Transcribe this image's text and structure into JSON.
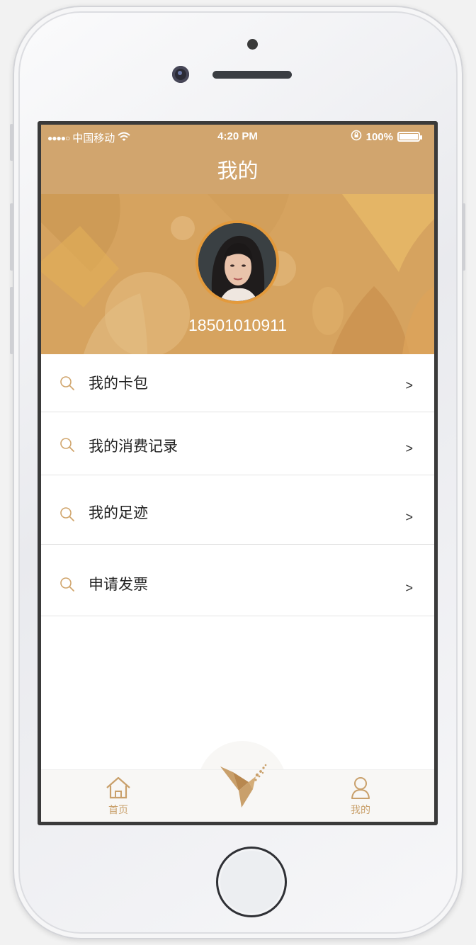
{
  "status_bar": {
    "signal": "●●●●○",
    "carrier": "中国移动",
    "time": "4:20 PM",
    "battery": "100%"
  },
  "header": {
    "title": "我的"
  },
  "profile": {
    "phone": "18501010911"
  },
  "menu": {
    "items": [
      {
        "label": "我的卡包",
        "icon": "search-icon",
        "arrow": ">"
      },
      {
        "label": "我的消费记录",
        "icon": "search-icon",
        "arrow": ">"
      },
      {
        "label": "我的足迹",
        "icon": "search-icon",
        "arrow": ">"
      },
      {
        "label": "申请发票",
        "icon": "search-icon",
        "arrow": ">"
      }
    ]
  },
  "tabbar": {
    "home_label": "首页",
    "mine_label": "我的",
    "home_icon": "home-icon",
    "mine_icon": "user-icon",
    "center_icon": "brand-logo-icon"
  },
  "colors": {
    "accent": "#d1a56e",
    "tab_text": "#c9a06b",
    "hero": "#d6a35f"
  }
}
